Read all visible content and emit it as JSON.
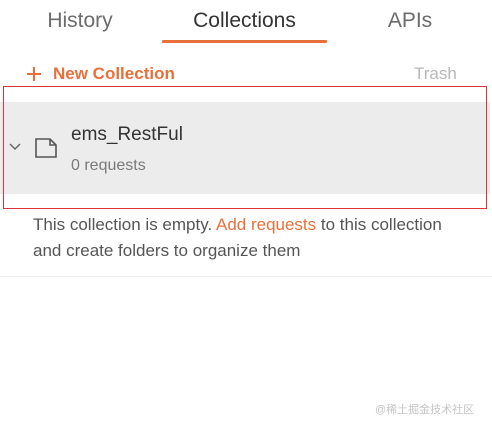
{
  "tabs": [
    {
      "label": "History",
      "active": false
    },
    {
      "label": "Collections",
      "active": true
    },
    {
      "label": "APIs",
      "active": false
    }
  ],
  "toolbar": {
    "new_collection_label": "New Collection",
    "trash_label": "Trash"
  },
  "collection": {
    "name": "ems_RestFul",
    "subtitle": "0 requests",
    "expanded": true
  },
  "empty_state": {
    "text_before": "This collection is empty. ",
    "link": "Add requests",
    "text_after": " to this collection and create folders to organize them"
  },
  "watermark": "@稀土掘金技术社区",
  "colors": {
    "accent": "#e8703a",
    "row_bg": "#ececec",
    "highlight_border": "#d9343a"
  },
  "icons": {
    "new_collection": "plus-icon",
    "expand": "chevron-down-icon",
    "collection": "folder-icon"
  }
}
